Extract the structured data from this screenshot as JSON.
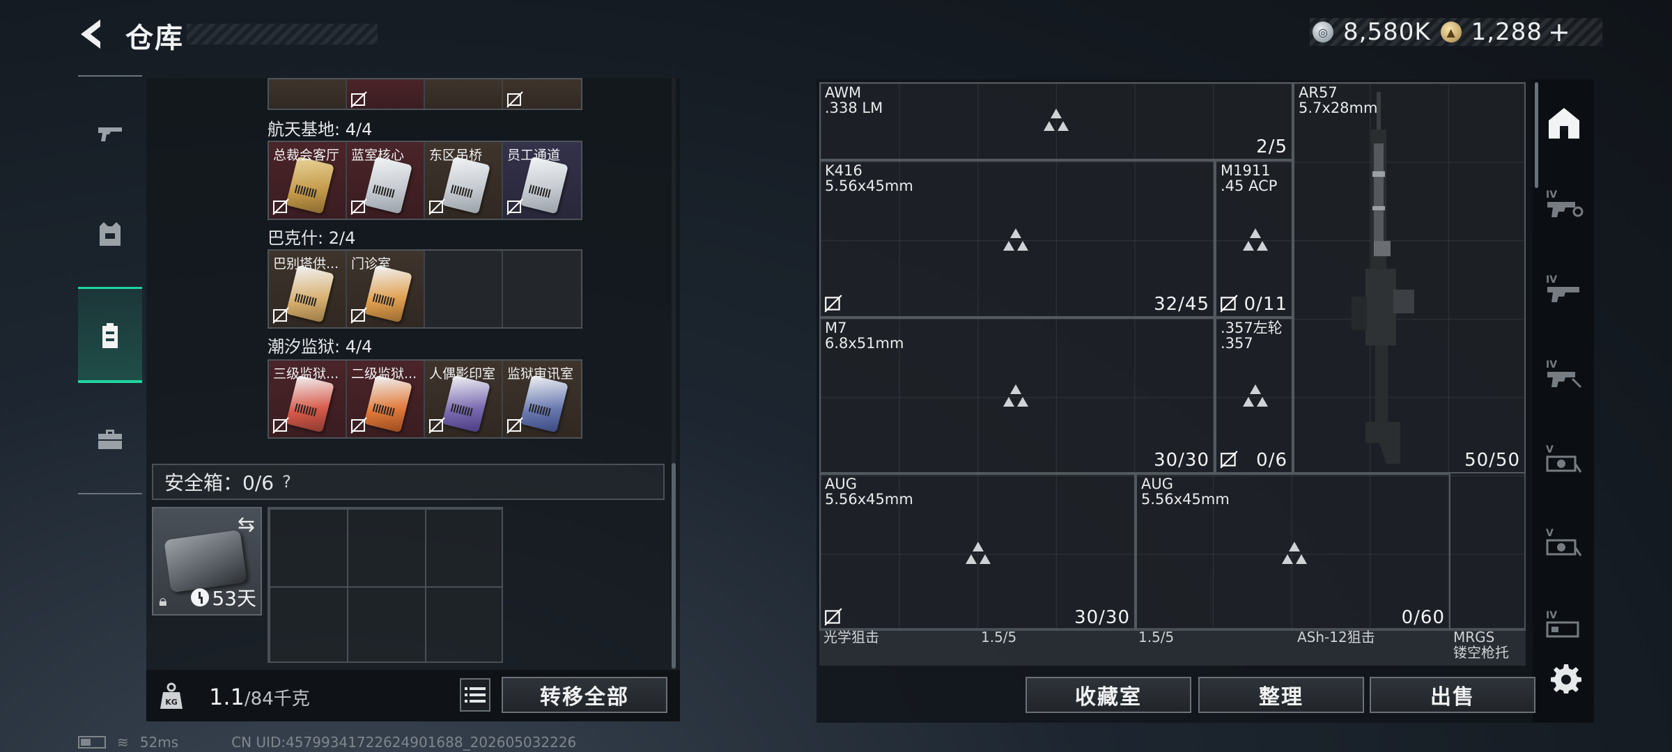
{
  "header": {
    "title": "仓库"
  },
  "currency": {
    "silver": "8,580K",
    "gold": "1,288",
    "plus": "+"
  },
  "nav": [
    "weapon",
    "vest",
    "backpack-active",
    "case"
  ],
  "groups": [
    {
      "label": "航天基地: 4/4",
      "cards": [
        {
          "name": "总裁会客厅",
          "bg": "red"
        },
        {
          "name": "蓝室核心",
          "bg": "red"
        },
        {
          "name": "东区吊桥",
          "bg": "brown"
        },
        {
          "name": "员工通道",
          "bg": "purple"
        }
      ]
    },
    {
      "label": "巴克什: 2/4",
      "cards": [
        {
          "name": "巴别塔供...",
          "bg": "brown"
        },
        {
          "name": "门诊室",
          "bg": "brown"
        }
      ]
    },
    {
      "label": "潮汐监狱: 4/4",
      "cards": [
        {
          "name": "三级监狱...",
          "bg": "red"
        },
        {
          "name": "二级监狱...",
          "bg": "red"
        },
        {
          "name": "人偶影印室",
          "bg": "brown"
        },
        {
          "name": "监狱审讯室",
          "bg": "brown"
        }
      ]
    }
  ],
  "safe": {
    "label": "安全箱：0/6",
    "help": "?",
    "days": "53天"
  },
  "weight": {
    "current": "1.1",
    "max": "/84千克"
  },
  "buttons": {
    "transfer_all": "转移全部",
    "collection": "收藏室",
    "organize": "整理",
    "sell": "出售"
  },
  "weapons": [
    {
      "name": "AWM",
      "caliber": ".338 LM",
      "ammo": "2/5"
    },
    {
      "name": "AR57",
      "caliber": "5.7x28mm",
      "ammo": "50/50"
    },
    {
      "name": "K416",
      "caliber": "5.56x45mm",
      "ammo": "32/45"
    },
    {
      "name": "M1911",
      "caliber": ".45 ACP",
      "ammo": "0/11"
    },
    {
      "name": "M7",
      "caliber": "6.8x51mm",
      "ammo": "30/30"
    },
    {
      "name": ".357左轮",
      "caliber": ".357",
      "ammo": "0/6"
    },
    {
      "name": "AUG",
      "caliber": "5.56x45mm",
      "ammo": "30/30"
    },
    {
      "name": "AUG",
      "caliber": "5.56x45mm",
      "ammo": "0/60"
    }
  ],
  "bottom_items": [
    "光学狙击",
    "1.5/5",
    "1.5/5",
    "ASh-12狙击",
    "MRGS",
    "镂空枪托"
  ],
  "status": {
    "ping": "52ms",
    "uid": "CN UID:4579934172262490168​8_202605032226"
  }
}
